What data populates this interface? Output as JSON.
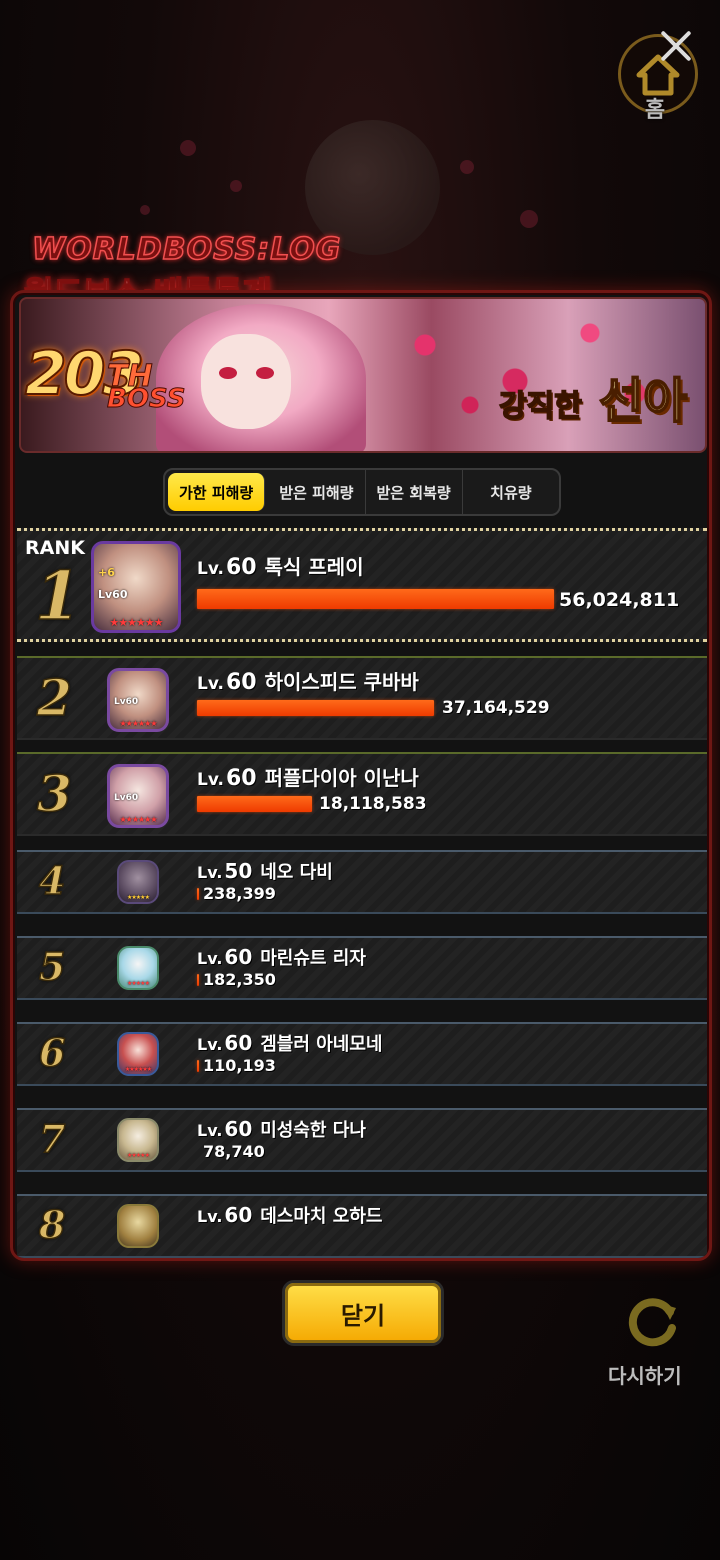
{
  "header": {
    "title_en": "WORLDBOSS:LOG",
    "title_ko": "월드보스·배틀통계",
    "home_label": "홈"
  },
  "banner": {
    "boss_number": "203",
    "boss_suffix": "TH",
    "boss_word": "BOSS",
    "boss_name_prefix": "강직한",
    "boss_name": "선아"
  },
  "tabs": [
    {
      "label": "가한 피해량",
      "active": true
    },
    {
      "label": "받은 피해량",
      "active": false
    },
    {
      "label": "받은 회복량",
      "active": false
    },
    {
      "label": "치유량",
      "active": false
    }
  ],
  "rank_header": "RANK",
  "rankings": [
    {
      "rank": "1",
      "lv_word": "Lv.",
      "level": "60",
      "name": "톡식 프레이",
      "value": "56,024,811",
      "ratio": 1.0,
      "portrait_badge": "Lv60",
      "portrait_plus": "+6"
    },
    {
      "rank": "2",
      "lv_word": "Lv.",
      "level": "60",
      "name": "하이스피드 쿠바바",
      "value": "37,164,529",
      "ratio": 0.663,
      "portrait_badge": "Lv60"
    },
    {
      "rank": "3",
      "lv_word": "Lv.",
      "level": "60",
      "name": "퍼플다이아 이난나",
      "value": "18,118,583",
      "ratio": 0.323,
      "portrait_badge": "Lv60"
    },
    {
      "rank": "4",
      "lv_word": "Lv.",
      "level": "50",
      "name": "네오 다비",
      "value": "238,399",
      "ratio": 0.004
    },
    {
      "rank": "5",
      "lv_word": "Lv.",
      "level": "60",
      "name": "마린슈트 리자",
      "value": "182,350",
      "ratio": 0.003
    },
    {
      "rank": "6",
      "lv_word": "Lv.",
      "level": "60",
      "name": "겜블러 아네모네",
      "value": "110,193",
      "ratio": 0.002
    },
    {
      "rank": "7",
      "lv_word": "Lv.",
      "level": "60",
      "name": "미성숙한 다나",
      "value": "78,740",
      "ratio": 0.001
    },
    {
      "rank": "8",
      "lv_word": "Lv.",
      "level": "60",
      "name": "데스마치 오하드",
      "value": "",
      "ratio": 0.0
    }
  ],
  "buttons": {
    "close": "닫기",
    "retry": "다시하기"
  },
  "colors": {
    "bar": "#ff5a10",
    "active_tab": "#ffd21a",
    "rank_number": "#d9b866",
    "panel_border": "#6e1714"
  }
}
